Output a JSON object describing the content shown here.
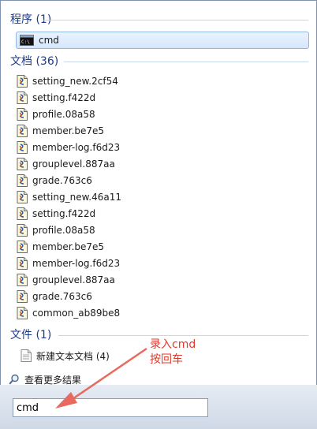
{
  "groups": {
    "programs": {
      "header": "程序 (1)",
      "items": [
        {
          "label": "cmd",
          "icon": "cmd-console-icon"
        }
      ]
    },
    "documents": {
      "header": "文档 (36)",
      "items": [
        {
          "label": "setting_new.2cf54"
        },
        {
          "label": "setting.f422d"
        },
        {
          "label": "profile.08a58"
        },
        {
          "label": "member.be7e5"
        },
        {
          "label": "member-log.f6d23"
        },
        {
          "label": "grouplevel.887aa"
        },
        {
          "label": "grade.763c6"
        },
        {
          "label": "setting_new.46a11"
        },
        {
          "label": "setting.f422d"
        },
        {
          "label": "profile.08a58"
        },
        {
          "label": "member.be7e5"
        },
        {
          "label": "member-log.f6d23"
        },
        {
          "label": "grouplevel.887aa"
        },
        {
          "label": "grade.763c6"
        },
        {
          "label": "common_ab89be8"
        }
      ]
    },
    "files": {
      "header": "文件 (1)",
      "items": [
        {
          "label": "新建文本文档 (4)",
          "icon": "text-file-icon"
        }
      ]
    }
  },
  "see_more": {
    "label": "查看更多结果",
    "icon": "magnifier-icon"
  },
  "search": {
    "value": "cmd"
  },
  "annotation": {
    "line1": "录入cmd",
    "line2": "按回车",
    "color": "#e0392b"
  }
}
